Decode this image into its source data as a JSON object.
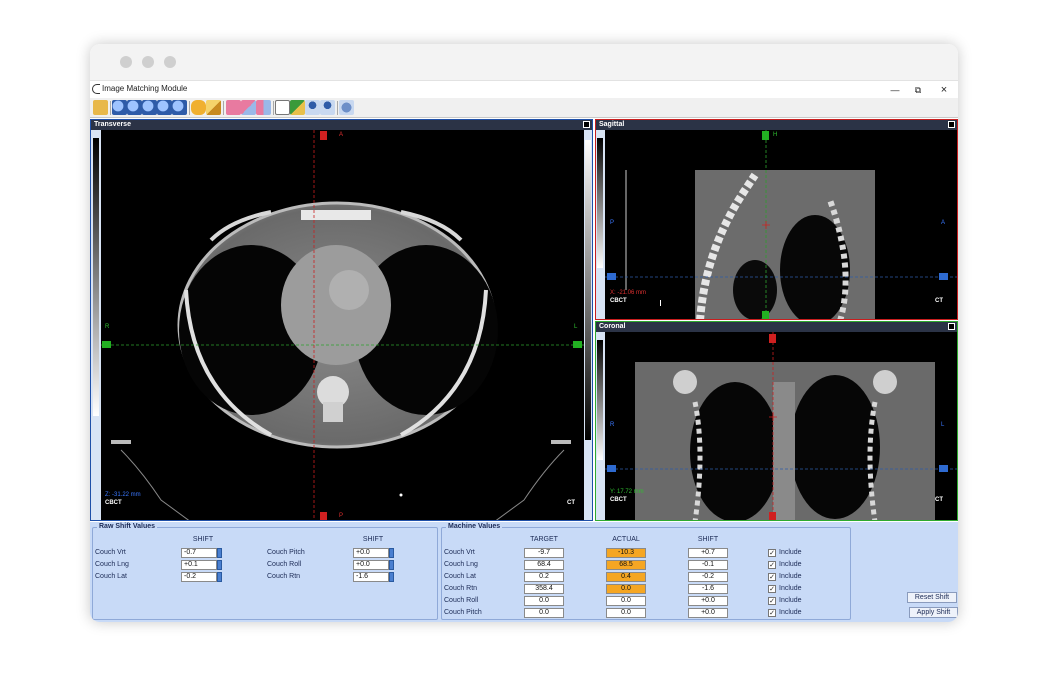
{
  "window": {
    "title": "Image Matching Module",
    "minimize": "—",
    "restore": "⧉",
    "close": "×"
  },
  "toolbar": {
    "icons": [
      "open-icon",
      "zoom-in-icon",
      "zoom-out-icon",
      "zoom-fit-icon",
      "zoom-region-icon",
      "zoom-reset-icon",
      "hand-pan-icon",
      "pencil-icon",
      "overlay-icon",
      "blend-icon",
      "split-icon",
      "page-icon",
      "match-icon",
      "person-icon",
      "person-2-icon",
      "settings-icon"
    ]
  },
  "viewers": {
    "transverse": {
      "title": "Transverse",
      "coord": "Z: -31.22 mm",
      "left_label": "CBCT",
      "right_label": "CT",
      "tag_top": "A",
      "tag_bottom": "P",
      "tag_left": "R",
      "tag_right": "L"
    },
    "sagittal": {
      "title": "Sagittal",
      "coord": "X: -21.06 mm",
      "left_label": "CBCT",
      "right_label": "CT",
      "tag_top": "H",
      "tag_left": "P",
      "tag_right": "A"
    },
    "coronal": {
      "title": "Coronal",
      "coord": "Y: 17.72 mm",
      "left_label": "CBCT",
      "right_label": "CT",
      "tag_left": "R",
      "tag_right": "L"
    }
  },
  "raw_shift": {
    "title": "Raw Shift Values",
    "header": "SHIFT",
    "left_rows": [
      {
        "label": "Couch Vrt",
        "value": "-0.7"
      },
      {
        "label": "Couch Lng",
        "value": "+0.1"
      },
      {
        "label": "Couch Lat",
        "value": "-0.2"
      }
    ],
    "right_rows": [
      {
        "label": "Couch Pitch",
        "value": "+0.0"
      },
      {
        "label": "Couch Roll",
        "value": "+0.0"
      },
      {
        "label": "Couch Rtn",
        "value": "-1.6"
      }
    ]
  },
  "machine": {
    "title": "Machine Values",
    "headers": {
      "target": "TARGET",
      "actual": "ACTUAL",
      "shift": "SHIFT"
    },
    "include_label": "Include",
    "rows": [
      {
        "label": "Couch Vrt",
        "target": "-9.7",
        "actual": "-10.3",
        "shift": "+0.7",
        "highlight": true
      },
      {
        "label": "Couch Lng",
        "target": "68.4",
        "actual": "68.5",
        "shift": "-0.1",
        "highlight": true
      },
      {
        "label": "Couch Lat",
        "target": "0.2",
        "actual": "0.4",
        "shift": "-0.2",
        "highlight": true
      },
      {
        "label": "Couch Rtn",
        "target": "358.4",
        "actual": "0.0",
        "shift": "-1.6",
        "highlight": true
      },
      {
        "label": "Couch Roll",
        "target": "0.0",
        "actual": "0.0",
        "shift": "+0.0",
        "highlight": false
      },
      {
        "label": "Couch Pitch",
        "target": "0.0",
        "actual": "0.0",
        "shift": "+0.0",
        "highlight": false
      }
    ]
  },
  "buttons": {
    "reset": "Reset Shift",
    "apply": "Apply Shift"
  },
  "colors": {
    "highlight": "#f5a623",
    "transverse_border": "#1e4fa8",
    "sagittal_border": "#c81e1e",
    "coronal_border": "#2eaa2e"
  }
}
